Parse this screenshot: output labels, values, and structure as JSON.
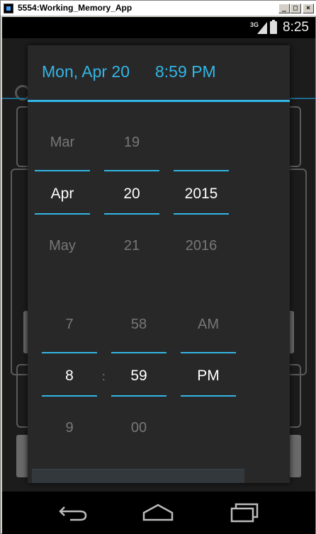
{
  "window": {
    "title": "5554:Working_Memory_App",
    "minimize_glyph": "_",
    "maximize_glyph": "□",
    "close_glyph": "×"
  },
  "status_bar": {
    "network": "3G",
    "time": "8:25"
  },
  "dialog": {
    "title_date": "Mon, Apr 20",
    "title_time": "8:59 PM",
    "date_picker": {
      "month": {
        "prev": "Mar",
        "selected": "Apr",
        "next": "May"
      },
      "day": {
        "prev": "19",
        "selected": "20",
        "next": "21"
      },
      "year": {
        "prev": "",
        "selected": "2015",
        "next": "2016"
      }
    },
    "time_picker": {
      "hour": {
        "prev": "7",
        "selected": "8",
        "next": "9"
      },
      "separator": ":",
      "minute": {
        "prev": "58",
        "selected": "59",
        "next": "00"
      },
      "ampm": {
        "prev": "AM",
        "selected": "PM",
        "next": ""
      }
    }
  },
  "colors": {
    "accent": "#33b5e5",
    "dialog_bg": "#282828"
  },
  "nav_bar": {
    "icons": [
      "back-icon",
      "home-icon",
      "recent-apps-icon"
    ]
  }
}
